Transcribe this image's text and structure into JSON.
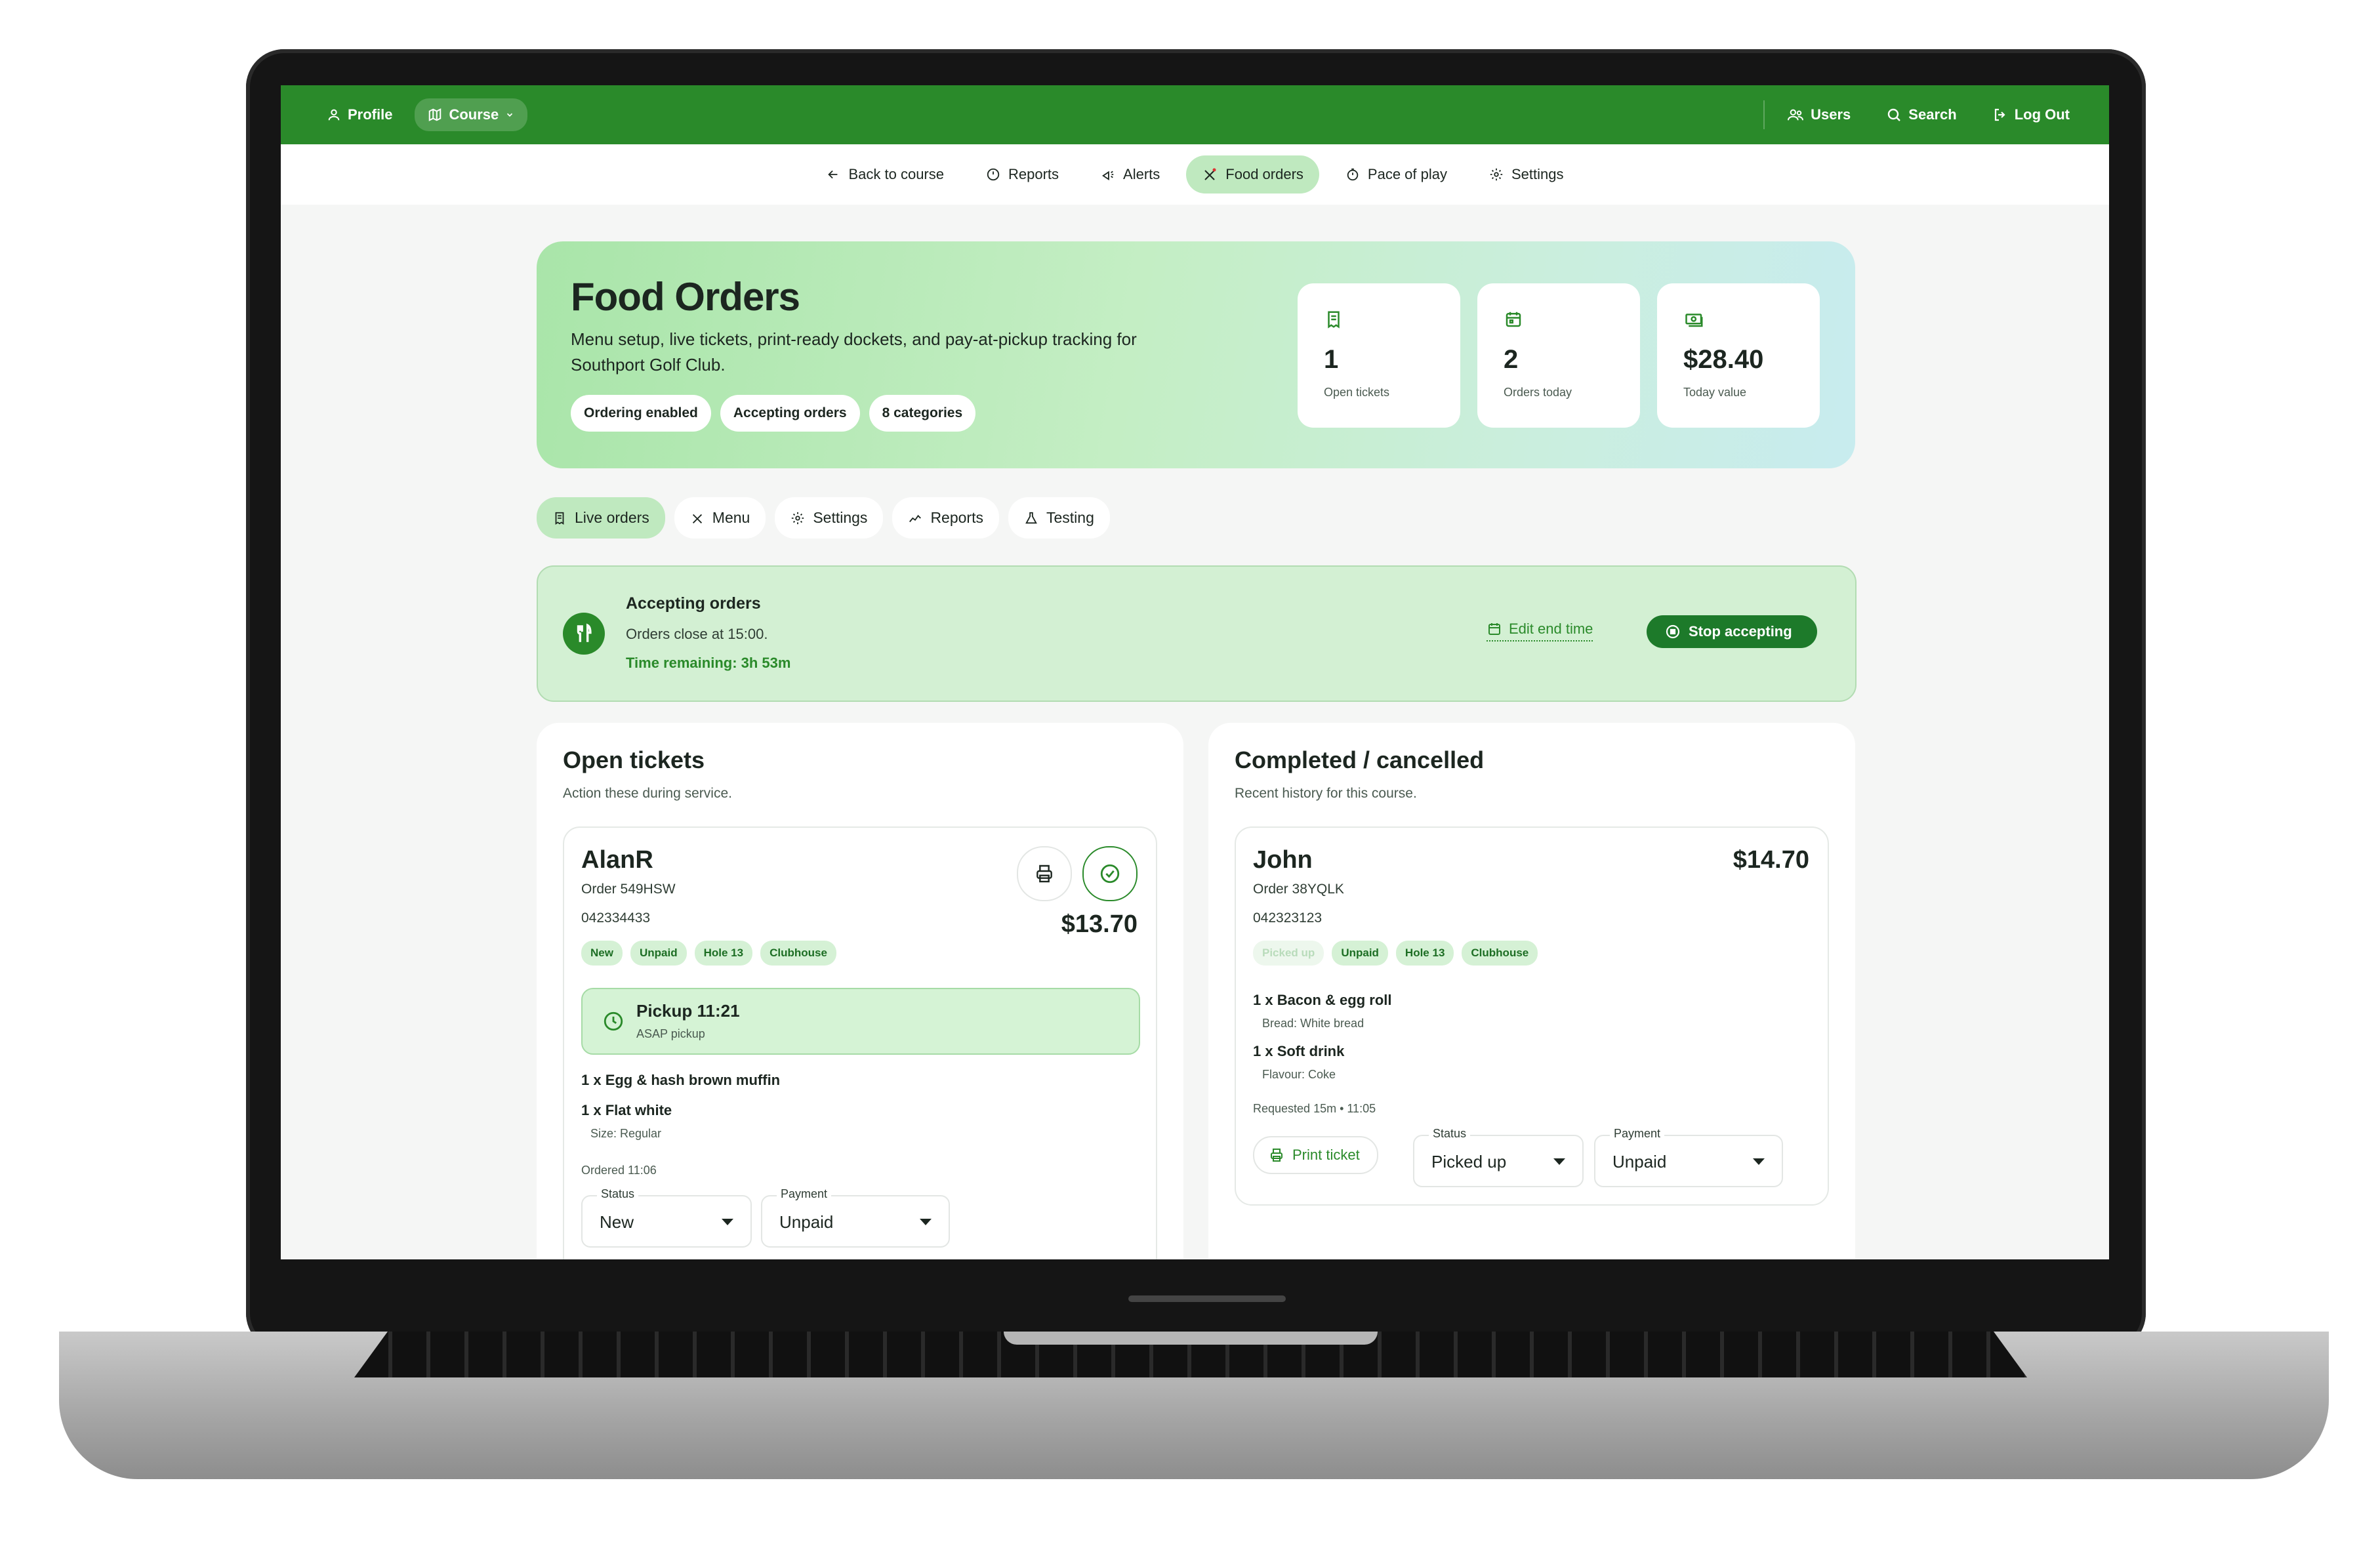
{
  "topbar": {
    "profile": "Profile",
    "course": "Course",
    "users": "Users",
    "search": "Search",
    "logout": "Log Out"
  },
  "subnav": {
    "back": "Back to course",
    "reports": "Reports",
    "alerts": "Alerts",
    "food_orders": "Food orders",
    "pace": "Pace of play",
    "settings": "Settings"
  },
  "hero": {
    "title": "Food Orders",
    "description": "Menu setup, live tickets, print-ready dockets, and pay-at-pickup tracking for Southport Golf Club.",
    "chips": [
      "Ordering enabled",
      "Accepting orders",
      "8 categories"
    ],
    "stats": [
      {
        "value": "1",
        "label": "Open tickets"
      },
      {
        "value": "2",
        "label": "Orders today"
      },
      {
        "value": "$28.40",
        "label": "Today value"
      }
    ]
  },
  "tabs": [
    "Live orders",
    "Menu",
    "Settings",
    "Reports",
    "Testing"
  ],
  "accepting": {
    "title": "Accepting orders",
    "subtitle": "Orders close at 15:00.",
    "remaining": "Time remaining: 3h 53m",
    "edit": "Edit end time",
    "stop": "Stop accepting"
  },
  "open": {
    "title": "Open tickets",
    "subtitle": "Action these during service.",
    "ticket": {
      "name": "AlanR",
      "order": "Order 549HSW",
      "phone": "042334433",
      "price": "$13.70",
      "tags": [
        "New",
        "Unpaid",
        "Hole 13",
        "Clubhouse"
      ],
      "pickup_title": "Pickup 11:21",
      "pickup_sub": "ASAP pickup",
      "item1": "1 x Egg & hash brown muffin",
      "item2": "1 x Flat white",
      "item2_note": "Size: Regular",
      "ordered": "Ordered 11:06",
      "status_label": "Status",
      "status_value": "New",
      "payment_label": "Payment",
      "payment_value": "Unpaid"
    }
  },
  "completed": {
    "title": "Completed / cancelled",
    "subtitle": "Recent history for this course.",
    "ticket": {
      "name": "John",
      "order": "Order 38YQLK",
      "phone": "042323123",
      "price": "$14.70",
      "tags": [
        "Picked up",
        "Unpaid",
        "Hole 13",
        "Clubhouse"
      ],
      "item1": "1 x Bacon & egg roll",
      "item1_note": "Bread: White bread",
      "item2": "1 x Soft drink",
      "item2_note": "Flavour: Coke",
      "requested": "Requested 15m • 11:05",
      "print": "Print ticket",
      "status_label": "Status",
      "status_value": "Picked up",
      "payment_label": "Payment",
      "payment_value": "Unpaid"
    }
  },
  "colors": {
    "brand": "#2a8a2a",
    "accent_light": "#bfe9bf",
    "stop_button": "#1d7a2a"
  },
  "icons": [
    "user-icon",
    "map-icon",
    "chevron-down-icon",
    "users-icon",
    "search-icon",
    "logout-icon",
    "arrow-left-icon",
    "clock-icon",
    "alert-icon",
    "utensils-icon",
    "timer-icon",
    "gear-icon",
    "receipt-icon",
    "calendar-icon",
    "cash-icon",
    "chart-icon",
    "flask-icon",
    "printer-icon",
    "check-circle-icon",
    "stop-icon"
  ]
}
